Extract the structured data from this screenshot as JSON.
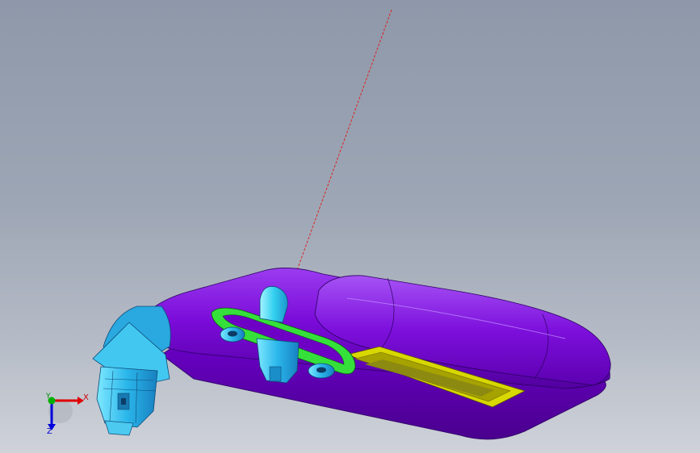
{
  "viewport": {
    "background_top": "#8e98a9",
    "background_bottom": "#cfd2d9"
  },
  "model": {
    "colors": {
      "housing": "#7a0ad8",
      "housing_highlight": "#9b3cf0",
      "housing_shadow": "#4c0094",
      "tray_frame": "#d8d800",
      "tray_inner": "#a6a200",
      "ring": "#35e03a",
      "connector": "#27b4e8",
      "connector_highlight": "#7ee8ff",
      "arm": "#2aa8e0",
      "construction_line": "#e02020"
    }
  },
  "triad": {
    "x_label": "X",
    "y_label": "Y",
    "z_label": "Z",
    "x_color": "#e00000",
    "y_color": "#00b000",
    "z_color": "#0000dd"
  }
}
